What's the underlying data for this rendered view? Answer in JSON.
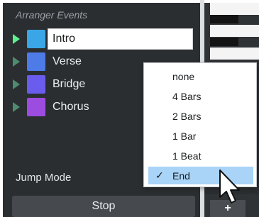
{
  "panel": {
    "title": "Arranger Events",
    "events": [
      {
        "label": "Intro",
        "color": "#3aa6e8",
        "selected": true
      },
      {
        "label": "Verse",
        "color": "#4d7be8",
        "selected": false
      },
      {
        "label": "Bridge",
        "color": "#6a5cec",
        "selected": false
      },
      {
        "label": "Chorus",
        "color": "#9c4de0",
        "selected": false
      }
    ],
    "jump_mode_label": "Jump Mode",
    "stop_label": "Stop"
  },
  "menu": {
    "items": [
      {
        "label": "none",
        "checked": false
      },
      {
        "label": "4 Bars",
        "checked": false
      },
      {
        "label": "2 Bars",
        "checked": false
      },
      {
        "label": "1 Bar",
        "checked": false
      },
      {
        "label": "1 Beat",
        "checked": false
      },
      {
        "label": "End",
        "checked": true
      }
    ],
    "check_glyph": "✓"
  },
  "piano": {
    "add_label": "+"
  },
  "colors": {
    "accent_selected": "#a9d3f7",
    "play_indicator": "#5ef08f"
  }
}
